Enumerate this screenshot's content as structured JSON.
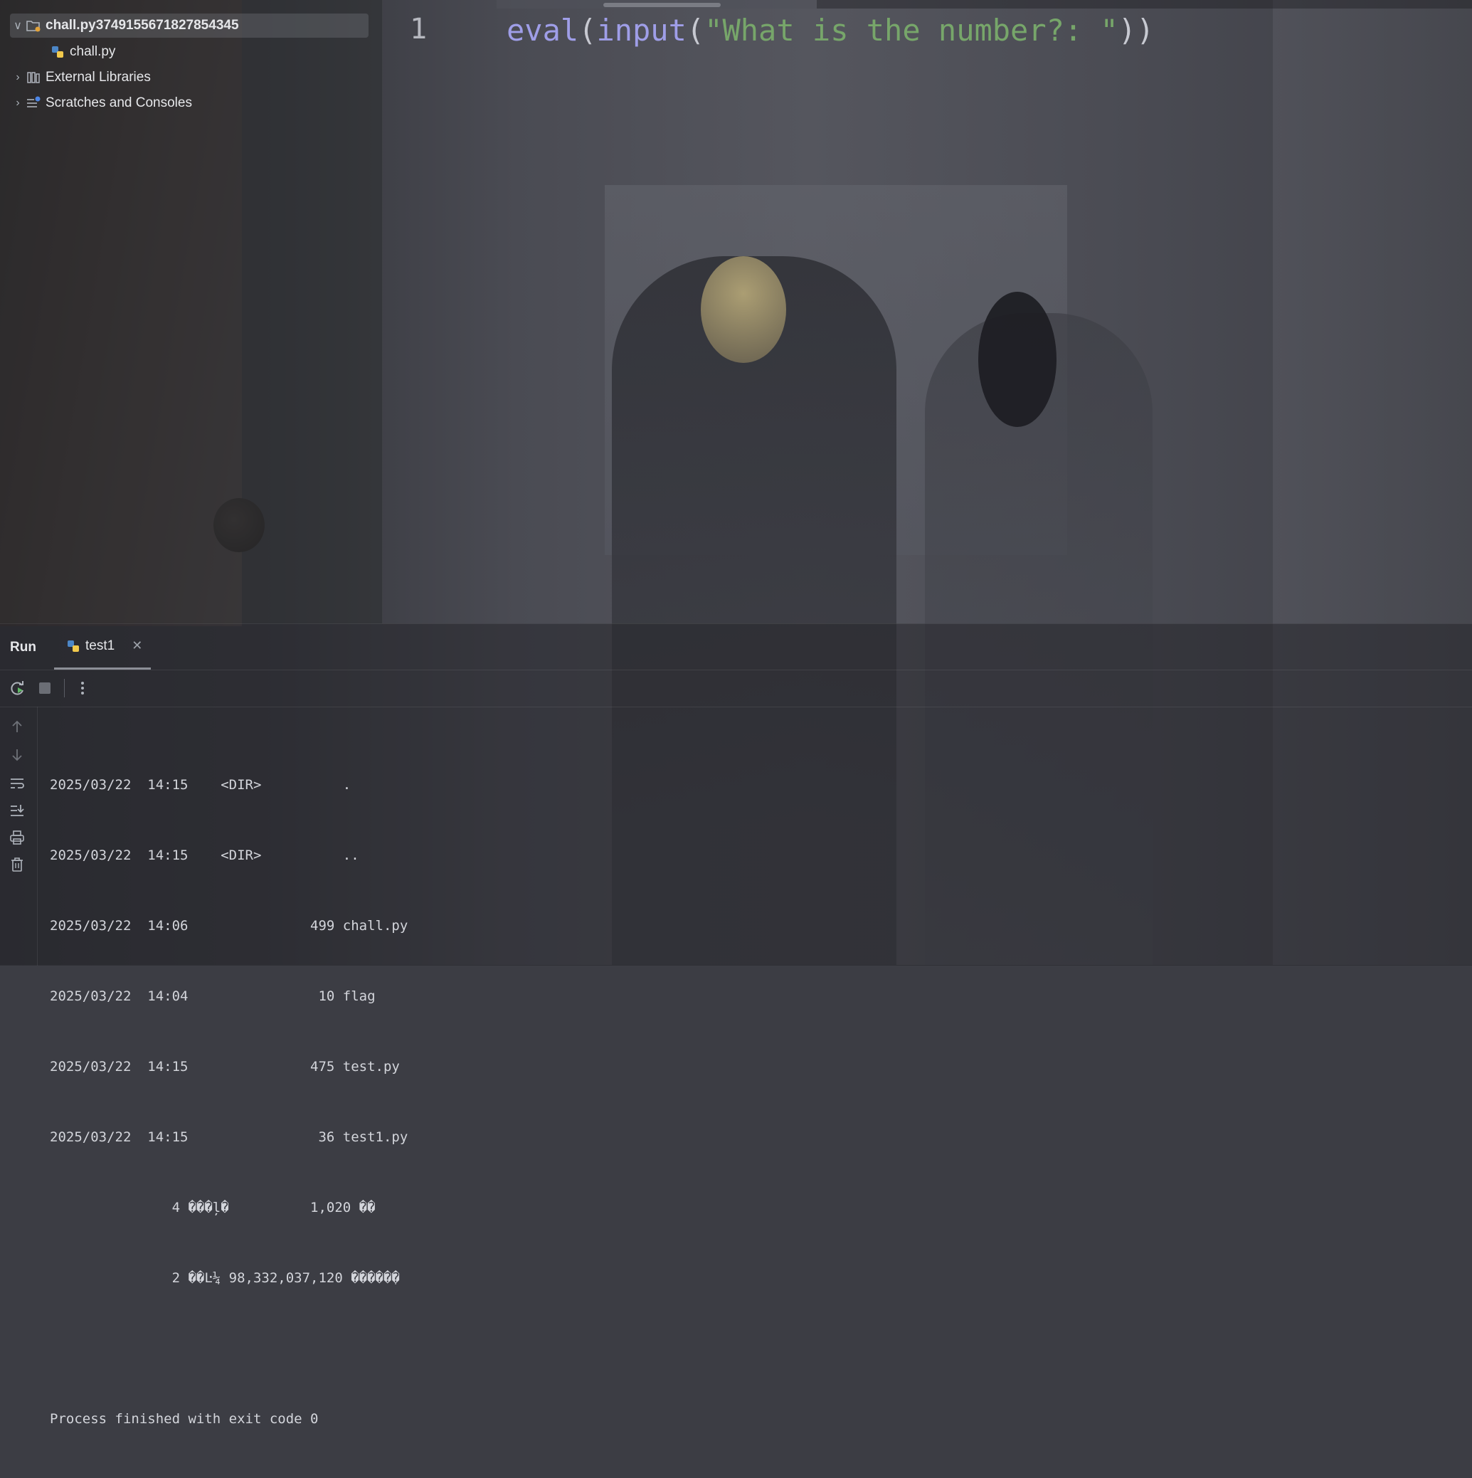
{
  "project": {
    "root_label": "chall.py3749155671827854345",
    "file_label": "chall.py",
    "external_libraries_label": "External Libraries",
    "scratches_label": "Scratches and Consoles"
  },
  "editor": {
    "line_number": "1",
    "code": {
      "fn_eval": "eval",
      "paren_open_1": "(",
      "fn_input": "input",
      "paren_open_2": "(",
      "string": "\"What is the number?: \"",
      "parens_close": "))"
    }
  },
  "run": {
    "title": "Run",
    "tab_label": "test1",
    "console_lines": [
      "2025/03/22  14:15    <DIR>          .",
      "2025/03/22  14:15    <DIR>          ..",
      "2025/03/22  14:06               499 chall.py",
      "2025/03/22  14:04                10 flag",
      "2025/03/22  14:15               475 test.py",
      "2025/03/22  14:15                36 test1.py",
      "               4 ���ļ�          1,020 ��",
      "               2 ��Ŀ¼ 98,332,037,120 �����ֽ�",
      "",
      "Process finished with exit code 0"
    ]
  },
  "colors": {
    "keyword": "#9f9ee8",
    "string": "#77a66a",
    "text": "#dfe1e5"
  }
}
